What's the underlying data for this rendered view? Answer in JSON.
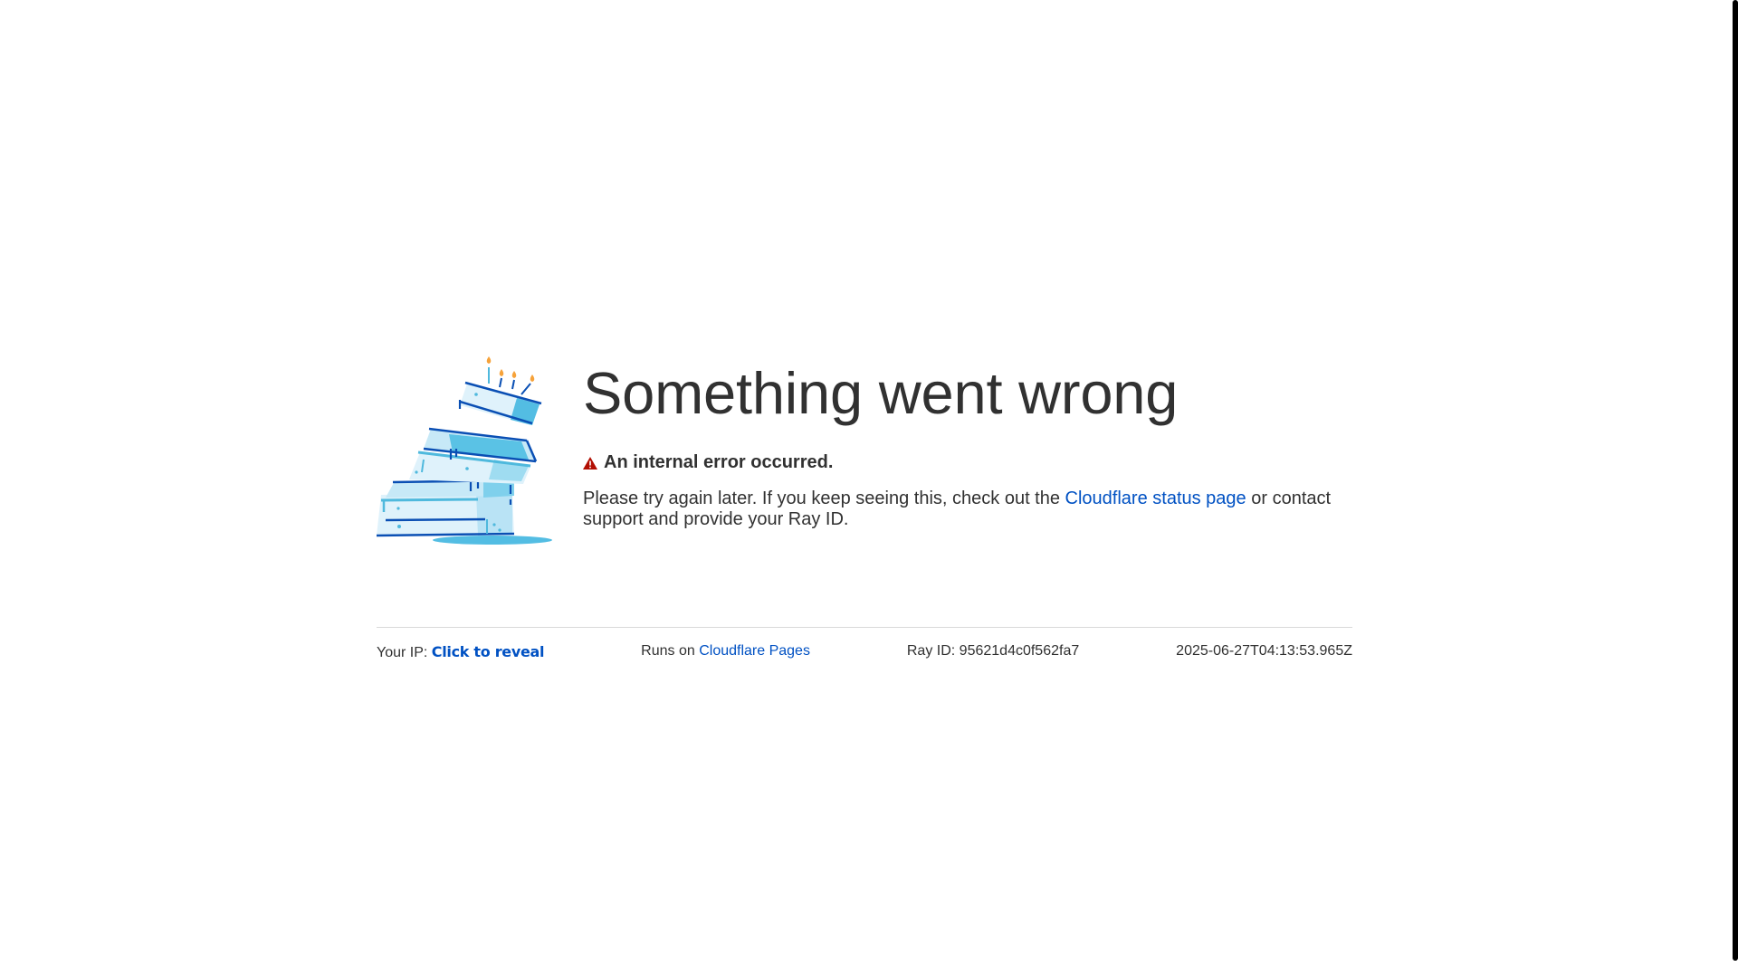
{
  "page": {
    "title": "Something went wrong",
    "error_heading": "An internal error occurred.",
    "description_before_link": "Please try again later. If you keep seeing this, check out the ",
    "status_link_text": "Cloudflare status page",
    "description_after_link": " or contact support and provide your Ray ID."
  },
  "footer": {
    "ip_label": "Your IP:",
    "ip_reveal": "Click to reveal",
    "runs_on_label": "Runs on",
    "runs_on_link": "Cloudflare Pages",
    "ray_id_label": "Ray ID:",
    "ray_id_value": "95621d4c0f562fa7",
    "timestamp": "2025-06-27T04:13:53.965Z"
  },
  "icons": {
    "illustration": "falling-cake-illustration",
    "warning": "warning-triangle-icon"
  },
  "colors": {
    "text": "#313131",
    "link": "#0051c3",
    "warning": "#c00000",
    "cake_dark": "#0a4fb4",
    "cake_light": "#4fb9dd",
    "divider": "#d9d9d9"
  }
}
